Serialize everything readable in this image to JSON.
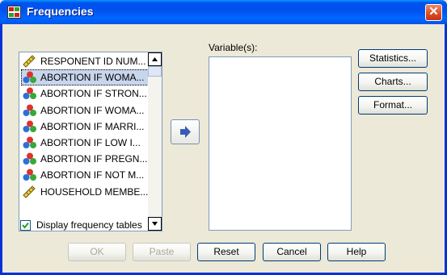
{
  "window": {
    "title": "Frequencies"
  },
  "variables_list": [
    {
      "label": "RESPONENT ID NUM...",
      "icon": "ruler-icon",
      "selected": false
    },
    {
      "label": "ABORTION IF WOMA...",
      "icon": "nominal-variable-icon",
      "selected": true
    },
    {
      "label": "ABORTION IF STRON...",
      "icon": "nominal-variable-icon",
      "selected": false
    },
    {
      "label": "ABORTION IF WOMA...",
      "icon": "nominal-variable-icon",
      "selected": false
    },
    {
      "label": "ABORTION IF MARRI...",
      "icon": "nominal-variable-icon",
      "selected": false
    },
    {
      "label": "ABORTION IF LOW I...",
      "icon": "nominal-variable-icon",
      "selected": false
    },
    {
      "label": "ABORTION IF PREGN...",
      "icon": "nominal-variable-icon",
      "selected": false
    },
    {
      "label": "ABORTION IF NOT M...",
      "icon": "nominal-variable-icon",
      "selected": false
    },
    {
      "label": "HOUSEHOLD MEMBE...",
      "icon": "ruler-icon",
      "selected": false
    }
  ],
  "target_label": "Variable(s):",
  "side_buttons": {
    "statistics": "Statistics...",
    "charts": "Charts...",
    "format": "Format..."
  },
  "checkbox": {
    "label": "Display frequency tables",
    "checked": true
  },
  "bottom_buttons": {
    "ok": "OK",
    "paste": "Paste",
    "reset": "Reset",
    "cancel": "Cancel",
    "help": "Help"
  }
}
